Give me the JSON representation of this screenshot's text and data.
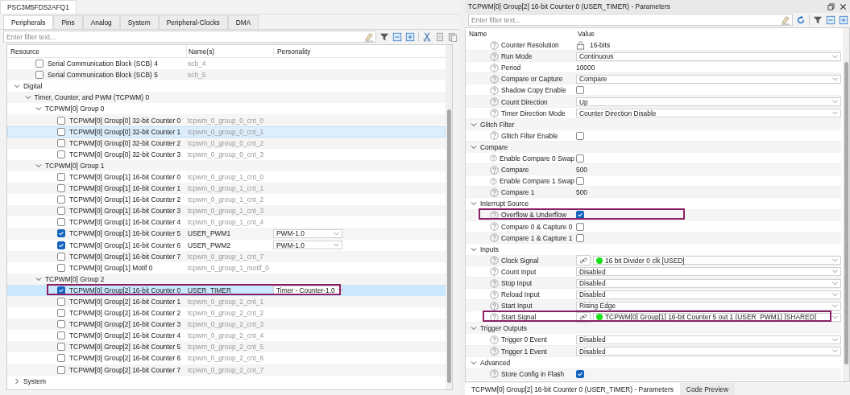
{
  "left": {
    "editor_tab": "PSC3M5FDS2AFQ1",
    "tabs": [
      {
        "label": "Peripherals",
        "selected": true
      },
      {
        "label": "Pins",
        "selected": false
      },
      {
        "label": "Analog",
        "selected": false
      },
      {
        "label": "System",
        "selected": false
      },
      {
        "label": "Peripheral-Clocks",
        "selected": false
      },
      {
        "label": "DMA",
        "selected": false
      }
    ],
    "filter": {
      "placeholder": "Enter filter text..."
    },
    "columns": [
      "Resource",
      "Name(s)",
      "Personality"
    ],
    "tree": [
      {
        "kind": "resource",
        "label": "Serial Communication Block (SCB) 4",
        "name": "scb_4",
        "checked": false,
        "selected": false,
        "hovered": false,
        "outlined": false
      },
      {
        "kind": "resource",
        "label": "Serial Communication Block (SCB) 5",
        "name": "scb_5",
        "checked": false,
        "selected": false,
        "hovered": false,
        "outlined": false
      },
      {
        "kind": "group",
        "label": "Digital",
        "expanded": true,
        "children": [
          {
            "kind": "group",
            "label": "Timer, Counter, and PWM (TCPWM) 0",
            "expanded": true,
            "children": [
              {
                "kind": "group",
                "label": "TCPWM[0] Group 0",
                "expanded": true,
                "children": [
                  {
                    "kind": "resource",
                    "label": "TCPWM[0] Group[0] 32-bit Counter 0",
                    "name": "tcpwm_0_group_0_cnt_0",
                    "checked": false,
                    "selected": false,
                    "hovered": false,
                    "outlined": false
                  },
                  {
                    "kind": "resource",
                    "label": "TCPWM[0] Group[0] 32-bit Counter 1",
                    "name": "tcpwm_0_group_0_cnt_1",
                    "checked": false,
                    "selected": false,
                    "hovered": true,
                    "outlined": false
                  },
                  {
                    "kind": "resource",
                    "label": "TCPWM[0] Group[0] 32-bit Counter 2",
                    "name": "tcpwm_0_group_0_cnt_2",
                    "checked": false,
                    "selected": false,
                    "hovered": false,
                    "outlined": false
                  },
                  {
                    "kind": "resource",
                    "label": "TCPWM[0] Group[0] 32-bit Counter 3",
                    "name": "tcpwm_0_group_0_cnt_3",
                    "checked": false,
                    "selected": false,
                    "hovered": false,
                    "outlined": false
                  }
                ]
              },
              {
                "kind": "group",
                "label": "TCPWM[0] Group 1",
                "expanded": true,
                "children": [
                  {
                    "kind": "resource",
                    "label": "TCPWM[0] Group[1] 16-bit Counter 0",
                    "name": "tcpwm_0_group_1_cnt_0",
                    "checked": false,
                    "selected": false,
                    "hovered": false,
                    "outlined": false
                  },
                  {
                    "kind": "resource",
                    "label": "TCPWM[0] Group[1] 16-bit Counter 1",
                    "name": "tcpwm_0_group_1_cnt_1",
                    "checked": false,
                    "selected": false,
                    "hovered": false,
                    "outlined": false
                  },
                  {
                    "kind": "resource",
                    "label": "TCPWM[0] Group[1] 16-bit Counter 2",
                    "name": "tcpwm_0_group_1_cnt_2",
                    "checked": false,
                    "selected": false,
                    "hovered": false,
                    "outlined": false
                  },
                  {
                    "kind": "resource",
                    "label": "TCPWM[0] Group[1] 16-bit Counter 3",
                    "name": "tcpwm_0_group_1_cnt_3",
                    "checked": false,
                    "selected": false,
                    "hovered": false,
                    "outlined": false
                  },
                  {
                    "kind": "resource",
                    "label": "TCPWM[0] Group[1] 16-bit Counter 4",
                    "name": "tcpwm_0_group_1_cnt_4",
                    "checked": false,
                    "selected": false,
                    "hovered": false,
                    "outlined": false
                  },
                  {
                    "kind": "resource",
                    "label": "TCPWM[0] Group[1] 16-bit Counter 5",
                    "name": "USER_PWM1",
                    "personality": "PWM-1.0",
                    "checked": true,
                    "selected": false,
                    "hovered": false,
                    "outlined": false
                  },
                  {
                    "kind": "resource",
                    "label": "TCPWM[0] Group[1] 16-bit Counter 6",
                    "name": "USER_PWM2",
                    "personality": "PWM-1.0",
                    "checked": true,
                    "selected": false,
                    "hovered": false,
                    "outlined": false
                  },
                  {
                    "kind": "resource",
                    "label": "TCPWM[0] Group[1] 16-bit Counter 7",
                    "name": "tcpwm_0_group_1_cnt_7",
                    "checked": false,
                    "selected": false,
                    "hovered": false,
                    "outlined": false
                  },
                  {
                    "kind": "resource",
                    "label": "TCPWM[0] Group[1] Motif 0",
                    "name": "tcpwm_0_group_1_motif_0",
                    "checked": false,
                    "selected": false,
                    "hovered": false,
                    "outlined": false
                  }
                ]
              },
              {
                "kind": "group",
                "label": "TCPWM[0] Group 2",
                "expanded": true,
                "children": [
                  {
                    "kind": "resource",
                    "label": "TCPWM[0] Group[2] 16-bit Counter 0",
                    "name": "USER_TIMER",
                    "personality": "Timer - Counter-1.0",
                    "checked": true,
                    "selected": true,
                    "hovered": false,
                    "outlined": true
                  },
                  {
                    "kind": "resource",
                    "label": "TCPWM[0] Group[2] 16-bit Counter 1",
                    "name": "tcpwm_0_group_2_cnt_1",
                    "checked": false,
                    "selected": false,
                    "hovered": false,
                    "outlined": false
                  },
                  {
                    "kind": "resource",
                    "label": "TCPWM[0] Group[2] 16-bit Counter 2",
                    "name": "tcpwm_0_group_2_cnt_2",
                    "checked": false,
                    "selected": false,
                    "hovered": false,
                    "outlined": false
                  },
                  {
                    "kind": "resource",
                    "label": "TCPWM[0] Group[2] 16-bit Counter 3",
                    "name": "tcpwm_0_group_2_cnt_3",
                    "checked": false,
                    "selected": false,
                    "hovered": false,
                    "outlined": false
                  },
                  {
                    "kind": "resource",
                    "label": "TCPWM[0] Group[2] 16-bit Counter 4",
                    "name": "tcpwm_0_group_2_cnt_4",
                    "checked": false,
                    "selected": false,
                    "hovered": false,
                    "outlined": false
                  },
                  {
                    "kind": "resource",
                    "label": "TCPWM[0] Group[2] 16-bit Counter 5",
                    "name": "tcpwm_0_group_2_cnt_5",
                    "checked": false,
                    "selected": false,
                    "hovered": false,
                    "outlined": false
                  },
                  {
                    "kind": "resource",
                    "label": "TCPWM[0] Group[2] 16-bit Counter 6",
                    "name": "tcpwm_0_group_2_cnt_6",
                    "checked": false,
                    "selected": false,
                    "hovered": false,
                    "outlined": false
                  },
                  {
                    "kind": "resource",
                    "label": "TCPWM[0] Group[2] 16-bit Counter 7",
                    "name": "tcpwm_0_group_2_cnt_7",
                    "checked": false,
                    "selected": false,
                    "hovered": false,
                    "outlined": false
                  }
                ]
              }
            ]
          }
        ]
      },
      {
        "kind": "group",
        "label": "System",
        "expanded": false
      }
    ]
  },
  "right": {
    "title": "TCPWM[0] Group[2] 16-bit Counter 0 (USER_TIMER) - Parameters",
    "filter": {
      "placeholder": "Enter filter text..."
    },
    "columns": [
      "Name",
      "Value"
    ],
    "rows": [
      {
        "kind": "locked",
        "label": "Counter Resolution",
        "value": "16-bits",
        "outlined": false
      },
      {
        "kind": "dropdown",
        "label": "Run Mode",
        "value": "Continuous",
        "outlined": false
      },
      {
        "kind": "text",
        "label": "Period",
        "value": "10000",
        "outlined": false
      },
      {
        "kind": "dropdown",
        "label": "Compare or Capture",
        "value": "Compare",
        "outlined": false
      },
      {
        "kind": "checkbox",
        "label": "Shadow Copy Enable",
        "checked": false,
        "outlined": false
      },
      {
        "kind": "dropdown",
        "label": "Count Direction",
        "value": "Up",
        "outlined": false
      },
      {
        "kind": "dropdown",
        "label": "Timer Direction Mode",
        "value": "Counter Direction Disable",
        "outlined": false
      },
      {
        "kind": "category",
        "label": "Glitch Filter",
        "expanded": true,
        "children": [
          {
            "kind": "checkbox",
            "label": "Glitch Filter Enable",
            "checked": false,
            "outlined": false
          }
        ]
      },
      {
        "kind": "category",
        "label": "Compare",
        "expanded": true,
        "children": [
          {
            "kind": "checkbox",
            "label": "Enable Compare 0 Swap",
            "checked": false,
            "outlined": false
          },
          {
            "kind": "text",
            "label": "Compare",
            "value": "500",
            "outlined": false
          },
          {
            "kind": "checkbox",
            "label": "Enable Compare 1 Swap",
            "checked": false,
            "outlined": false
          },
          {
            "kind": "text",
            "label": "Compare 1",
            "value": "500",
            "outlined": false
          }
        ]
      },
      {
        "kind": "category",
        "label": "Interrupt Source",
        "expanded": true,
        "children": [
          {
            "kind": "checkbox",
            "label": "Overflow & Underflow",
            "checked": true,
            "outlined": true
          },
          {
            "kind": "checkbox",
            "label": "Compare 0 & Capture 0",
            "checked": false,
            "outlined": false
          },
          {
            "kind": "checkbox",
            "label": "Compare 1 & Capture 1",
            "checked": false,
            "outlined": false
          }
        ]
      },
      {
        "kind": "category",
        "label": "Inputs",
        "expanded": true,
        "children": [
          {
            "kind": "signal",
            "label": "Clock Signal",
            "value": "16 bit Divider 0 clk [USED]",
            "outlined": false
          },
          {
            "kind": "dropdown",
            "label": "Count Input",
            "value": "Disabled",
            "outlined": false
          },
          {
            "kind": "dropdown",
            "label": "Stop Input",
            "value": "Disabled",
            "outlined": false
          },
          {
            "kind": "dropdown",
            "label": "Reload Input",
            "value": "Disabled",
            "outlined": false
          },
          {
            "kind": "dropdown",
            "label": "Start Input",
            "value": "Rising Edge",
            "outlined": false
          },
          {
            "kind": "signal",
            "label": "Start Signal",
            "value": "TCPWM[0] Group[1] 16-bit Counter 5 out 1 (USER_PWM1) [SHARED]",
            "outlined": true
          }
        ]
      },
      {
        "kind": "category",
        "label": "Trigger Outputs",
        "expanded": true,
        "children": [
          {
            "kind": "dropdown",
            "label": "Trigger 0 Event",
            "value": "Disabled",
            "outlined": false
          },
          {
            "kind": "dropdown",
            "label": "Trigger 1 Event",
            "value": "Disabled",
            "outlined": false
          }
        ]
      },
      {
        "kind": "category",
        "label": "Advanced",
        "expanded": true,
        "children": [
          {
            "kind": "checkbox",
            "label": "Store Config in Flash",
            "checked": true,
            "outlined": false
          }
        ]
      }
    ],
    "bottom_tabs": [
      {
        "label": "TCPWM[0] Group[2] 16-bit Counter 0 (USER_TIMER) - Parameters",
        "selected": true
      },
      {
        "label": "Code Preview",
        "selected": false
      }
    ]
  }
}
